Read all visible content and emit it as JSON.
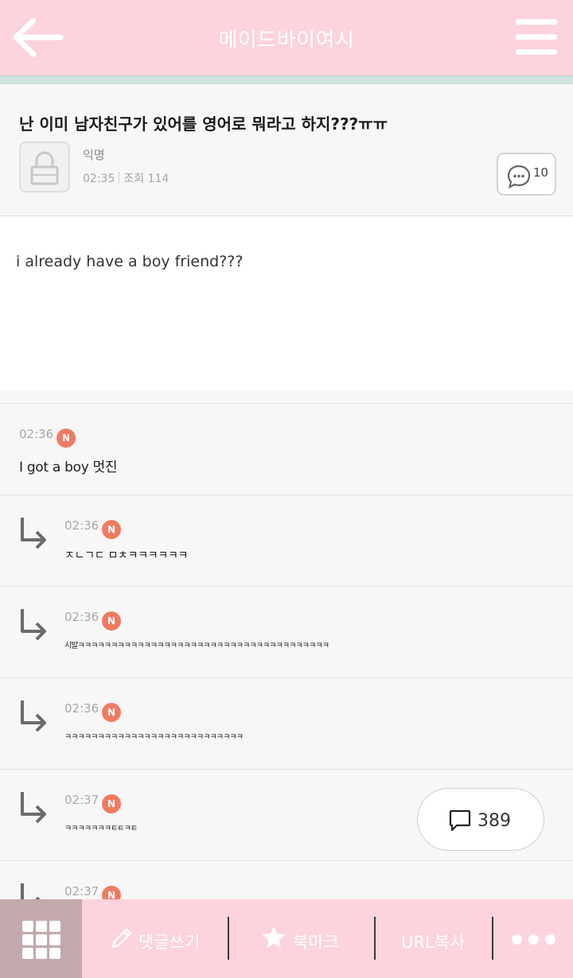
{
  "header": {
    "title": "메이드바이여시"
  },
  "post": {
    "title": "난 이미 남자친구가 있어를 영어로 뭐라고 하지???ㅠㅠ",
    "author": "익명",
    "time": "02:35",
    "views": "조회 114",
    "comment_count": "10",
    "body": "i already have a boy friend???"
  },
  "badge_label": "N",
  "comments": [
    {
      "time": "02:36",
      "text": "I got a boy 멋진",
      "reply": false
    },
    {
      "time": "02:36",
      "text": "ㅈㄴㄱㄷ ㅁㅊㅋㅋㅋㅋㅋㅋ",
      "reply": true
    },
    {
      "time": "02:36",
      "text": "시발ㅋㅋㅋㅋㅋㅋㅋㅋㅋㅋㅋㅋㅋㅋㅋㅋㅋㅋㅋㅋㅋㅋㅋㅋㅋㅋㅋㅋㅋㅋㅋㅋㅋㅋㅋㅋㅋㅋ",
      "reply": true
    },
    {
      "time": "02:36",
      "text": "ㅋㅋㅋㅋㅋㅋㅋㅋㅋㅋㅋㅋㅋㅋㅋㅋㅋㅋㅋㅋㅋㅋㅋㅋㅋㅋㅋ",
      "reply": true
    },
    {
      "time": "02:37",
      "text": "ㅋㅋㅋㅋㅋㅋㅋㅌㅌㅋㅌ",
      "reply": true
    },
    {
      "time": "02:37",
      "text": "",
      "reply": true
    }
  ],
  "floating_comment_count": "389",
  "bottom_bar": {
    "write_comment": "댓글쓰기",
    "bookmark": "북마크",
    "copy_url": "URL복사"
  },
  "colors": {
    "header_bg": "#fdd3dd",
    "accent_strip": "#cfe3df",
    "badge": "#f07b61",
    "grid_button_bg": "#c3a8ac"
  }
}
